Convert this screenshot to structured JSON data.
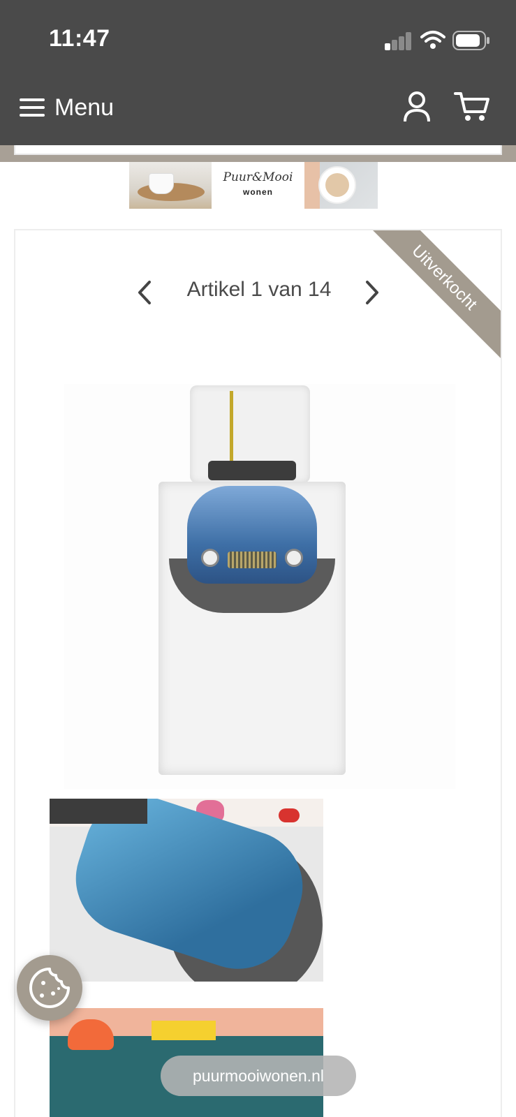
{
  "status_bar": {
    "time": "11:47"
  },
  "header": {
    "menu_label": "Menu",
    "icons": [
      "hamburger-icon",
      "user-icon",
      "cart-icon"
    ]
  },
  "banner": {
    "logo_text": "Puur&Mooi",
    "logo_subtext": "wonen"
  },
  "product": {
    "ribbon_label": "Uitverkocht",
    "pager_label": "Artikel 1 van 14",
    "ribbon_color": "#a39b8f"
  },
  "browser": {
    "url": "puurmooiwonen.nl"
  },
  "colors": {
    "header_bg": "#4a4a4a",
    "accent": "#a39b8f"
  }
}
